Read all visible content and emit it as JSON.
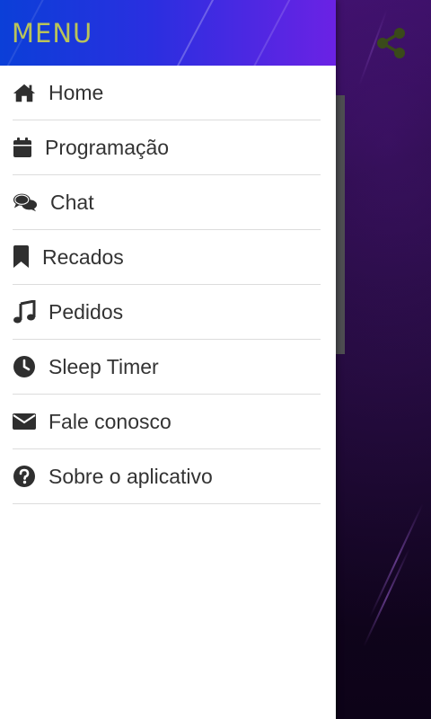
{
  "drawer": {
    "title": "MENU",
    "items": [
      {
        "label": "Home",
        "icon": "home-icon"
      },
      {
        "label": "Programação",
        "icon": "calendar-icon"
      },
      {
        "label": "Chat",
        "icon": "chat-icon"
      },
      {
        "label": "Recados",
        "icon": "bookmark-icon"
      },
      {
        "label": "Pedidos",
        "icon": "music-note-icon"
      },
      {
        "label": "Sleep Timer",
        "icon": "clock-icon"
      },
      {
        "label": "Fale conosco",
        "icon": "envelope-icon"
      },
      {
        "label": "Sobre o aplicativo",
        "icon": "question-circle-icon"
      }
    ]
  },
  "toolbar": {
    "share_icon": "share-icon"
  },
  "colors": {
    "header_gradient_start": "#0b3fd8",
    "header_gradient_end": "#6b22e4",
    "title_color": "#b9c35a",
    "icon_color": "#2f2f2f",
    "label_color": "#333333",
    "divider": "#dcdcdc",
    "share_icon_color": "#3a4a1a"
  }
}
